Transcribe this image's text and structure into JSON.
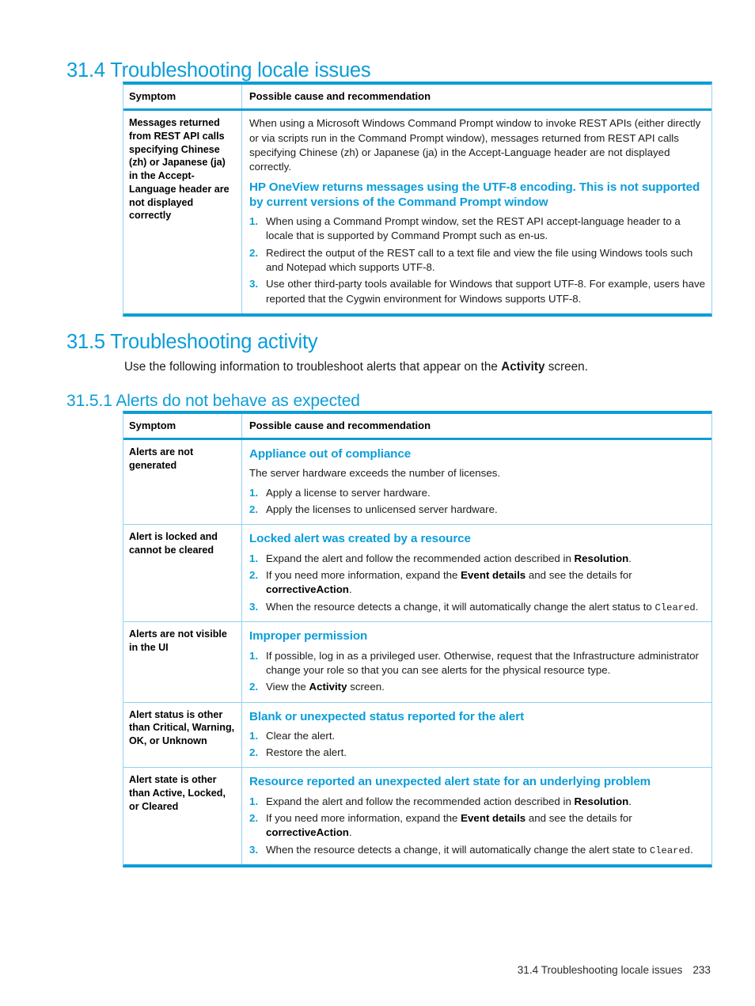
{
  "colors": {
    "accent": "#0b9dd9",
    "accent_light": "#8fd3ef",
    "text": "#1a1a1a"
  },
  "sections": {
    "s31_4": {
      "heading": "31.4 Troubleshooting locale issues"
    },
    "s31_5": {
      "heading": "31.5 Troubleshooting activity",
      "intro_a": "Use the following information to troubleshoot alerts that appear on the ",
      "intro_b": "Activity",
      "intro_c": " screen."
    },
    "s31_5_1": {
      "heading": "31.5.1 Alerts do not behave as expected"
    }
  },
  "table_locale": {
    "header": {
      "symptom": "Symptom",
      "recommendation": "Possible cause and recommendation"
    },
    "rows": [
      {
        "symptom": "Messages returned from REST API calls specifying Chinese (zh) or Japanese (ja) in the Accept-Language header are not displayed correctly",
        "paragraph": "When using a Microsoft Windows Command Prompt window to invoke REST APIs (either directly or via scripts run in the Command Prompt window), messages returned from REST API calls specifying Chinese (zh) or Japanese (ja) in the Accept-Language header are not displayed correctly.",
        "title": "HP OneView returns messages using the UTF-8 encoding. This is not supported by current versions of the Command Prompt window",
        "steps": [
          "When using a Command Prompt window, set the REST API accept-language header to a locale that is supported by Command Prompt such as en-us.",
          "Redirect the output of the REST call to a text file and view the file using Windows tools such and Notepad which supports UTF-8.",
          "Use other third-party tools available for Windows that support UTF-8. For example, users have reported that the Cygwin environment for Windows supports UTF-8."
        ]
      }
    ]
  },
  "table_alerts": {
    "header": {
      "symptom": "Symptom",
      "recommendation": "Possible cause and recommendation"
    },
    "rows": [
      {
        "symptom": "Alerts are not generated",
        "title": "Appliance out of compliance",
        "paragraph": "The server hardware exceeds the number of licenses.",
        "steps": [
          {
            "text_1": "Apply a license to server hardware."
          },
          {
            "text_1": "Apply the licenses to unlicensed server hardware."
          }
        ]
      },
      {
        "symptom": "Alert is locked and cannot be cleared",
        "title": "Locked alert was created by a resource",
        "paragraph": "",
        "steps": [
          {
            "text_1": "Expand the alert and follow the recommended action described in ",
            "bold_1": "Resolution",
            "text_2": "."
          },
          {
            "text_1": "If you need more information, expand the ",
            "bold_1": "Event details",
            "text_2": " and see the details for ",
            "bold_2": "correctiveAction",
            "text_3": "."
          },
          {
            "text_1": "When the resource detects a change, it will automatically change the alert status to ",
            "mono_1": "Cleared",
            "text_2": "."
          }
        ]
      },
      {
        "symptom": "Alerts are not visible in the UI",
        "title": "Improper permission",
        "paragraph": "",
        "steps": [
          {
            "text_1": "If possible, log in as a privileged user. Otherwise, request that the Infrastructure administrator change your role so that you can see alerts for the physical resource type."
          },
          {
            "text_1": "View the ",
            "bold_1": "Activity",
            "text_2": " screen."
          }
        ]
      },
      {
        "symptom": "Alert status is other than Critical, Warning, OK, or Unknown",
        "title": "Blank or unexpected status reported for the alert",
        "paragraph": "",
        "steps": [
          {
            "text_1": "Clear the alert."
          },
          {
            "text_1": "Restore the alert."
          }
        ]
      },
      {
        "symptom": "Alert state is other than Active, Locked, or Cleared",
        "title": "Resource reported an unexpected alert state for an underlying problem",
        "paragraph": "",
        "steps": [
          {
            "text_1": "Expand the alert and follow the recommended action described in ",
            "bold_1": "Resolution",
            "text_2": "."
          },
          {
            "text_1": "If you need more information, expand the ",
            "bold_1": "Event details",
            "text_2": " and see the details for ",
            "bold_2": "correctiveAction",
            "text_3": "."
          },
          {
            "text_1": "When the resource detects a change, it will automatically change the alert state to ",
            "mono_1": "Cleared",
            "text_2": "."
          }
        ]
      }
    ]
  },
  "footer": {
    "text": "31.4 Troubleshooting locale issues",
    "page_number": "233"
  }
}
